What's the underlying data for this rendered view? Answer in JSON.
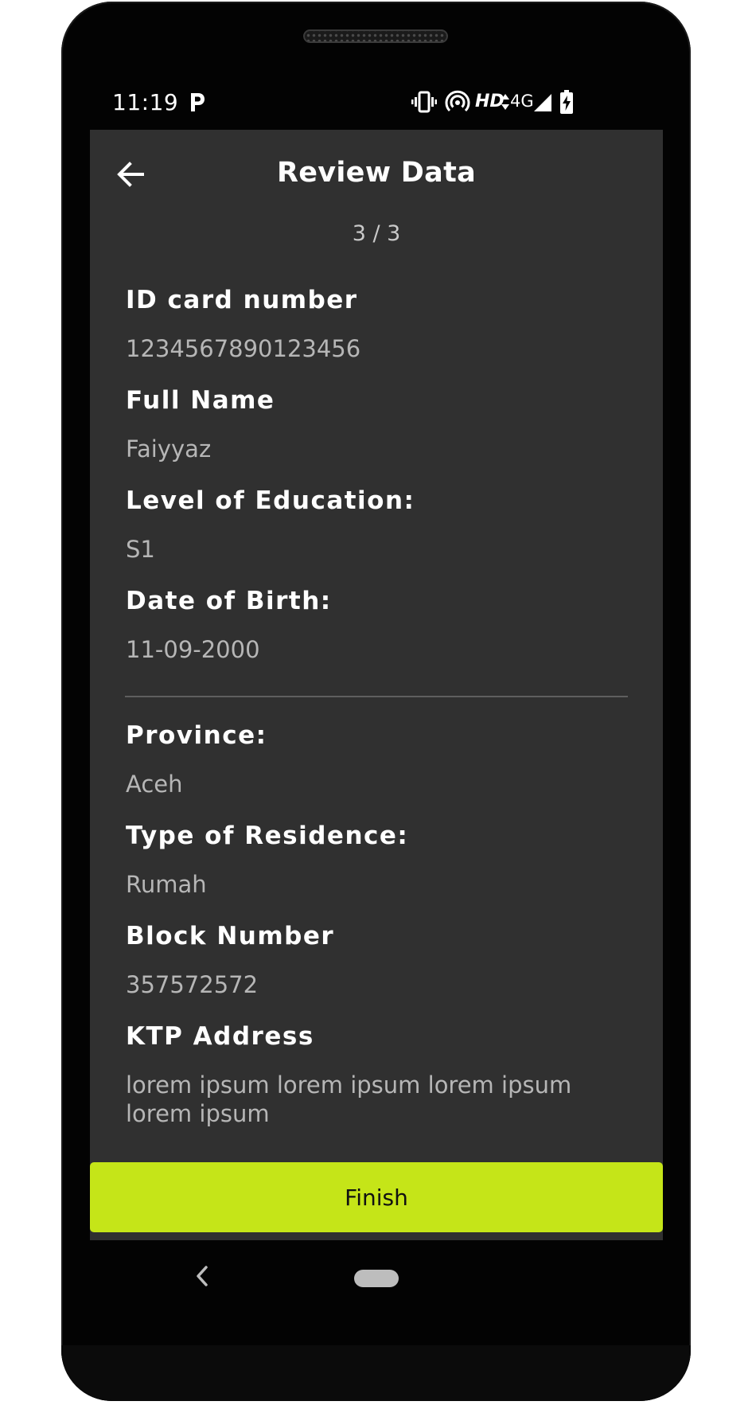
{
  "status_bar": {
    "time": "11:19",
    "network_label": "HD",
    "network_type": "4G",
    "icons": [
      "parking-icon",
      "vibrate-icon",
      "hotspot-icon",
      "data-arrows-icon",
      "signal-icon",
      "battery-charging-icon"
    ]
  },
  "app_bar": {
    "title": "Review Data",
    "back_icon": "arrow-left-icon"
  },
  "step_indicator": "3 / 3",
  "personal_fields": [
    {
      "label": "ID card number",
      "value": "1234567890123456"
    },
    {
      "label": "Full Name",
      "value": "Faiyyaz"
    },
    {
      "label": "Level of Education:",
      "value": "S1"
    },
    {
      "label": "Date of Birth:",
      "value": "11-09-2000"
    }
  ],
  "residence_fields": [
    {
      "label": "Province:",
      "value": "Aceh"
    },
    {
      "label": "Type of Residence:",
      "value": "Rumah"
    },
    {
      "label": "Block Number",
      "value": "357572572"
    },
    {
      "label": "KTP Address",
      "value": "lorem ipsum lorem ipsum lorem ipsum lorem ipsum"
    }
  ],
  "finish_button": {
    "label": "Finish"
  },
  "colors": {
    "screen_background": "#303030",
    "accent": "#c5e518",
    "label_text": "#ffffff",
    "value_text": "#b6b6b6"
  },
  "nav_bar": {
    "back_icon": "nav-back-chevron-icon",
    "home_icon": "home-pill-icon"
  }
}
